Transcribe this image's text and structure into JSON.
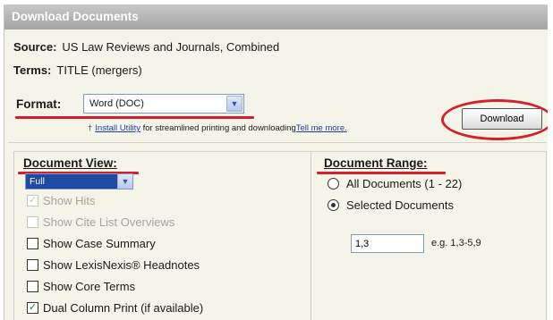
{
  "title": "Download Documents",
  "source": {
    "label": "Source:",
    "value": "US Law Reviews and Journals, Combined"
  },
  "terms": {
    "label": "Terms:",
    "value": "TITLE (mergers)"
  },
  "format": {
    "label": "Format:",
    "selected": "Word (DOC)",
    "arrow": "chevron-down-icon"
  },
  "utility": {
    "prefix_icon": "dagger-icon",
    "install_link": "Install Utility",
    "middle_text": " for streamlined printing and downloading",
    "tell_me_link": "Tell me more."
  },
  "download_button": "Download",
  "document_view": {
    "title": "Document View:",
    "selected": "Full",
    "options": [
      {
        "label": "Show Hits",
        "checked": true,
        "disabled": true
      },
      {
        "label": "Show Cite List Overviews",
        "checked": false,
        "disabled": true
      },
      {
        "label": "Show Case Summary",
        "checked": false,
        "disabled": false
      },
      {
        "label": "Show LexisNexis® Headnotes",
        "checked": false,
        "disabled": false
      },
      {
        "label": "Show Core Terms",
        "checked": false,
        "disabled": false
      },
      {
        "label": "Dual Column Print (if available)",
        "checked": true,
        "disabled": false
      }
    ]
  },
  "document_range": {
    "title": "Document Range:",
    "all_label": "All Documents (1 - 22)",
    "selected_label": "Selected Documents",
    "selected_option": "selected",
    "input_value": "1,3",
    "hint": "e.g. 1,3-5,9"
  },
  "colors": {
    "annotation_red": "#d61f2c",
    "title_bar": "#b4b4b4",
    "select_highlight": "#1f4aa6",
    "link": "#1b3fa8"
  }
}
